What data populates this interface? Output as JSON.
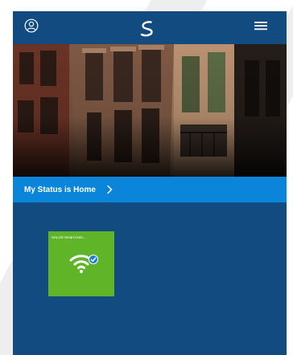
{
  "header": {
    "user_icon": "user-icon",
    "logo_icon": "salus-logo-icon",
    "menu_icon": "hamburger-menu-icon"
  },
  "status": {
    "label": "My Status is Home",
    "chevron_icon": "chevron-right-icon"
  },
  "devices": [
    {
      "label": "SALUS Smart Hom...",
      "icon": "wifi-icon",
      "badge_icon": "check-badge-icon",
      "color": "#5fb527"
    }
  ],
  "colors": {
    "app_background": "#124b7f",
    "status_bar": "#0a85d9",
    "tile": "#5fb527",
    "badge": "#1a7fd6"
  }
}
